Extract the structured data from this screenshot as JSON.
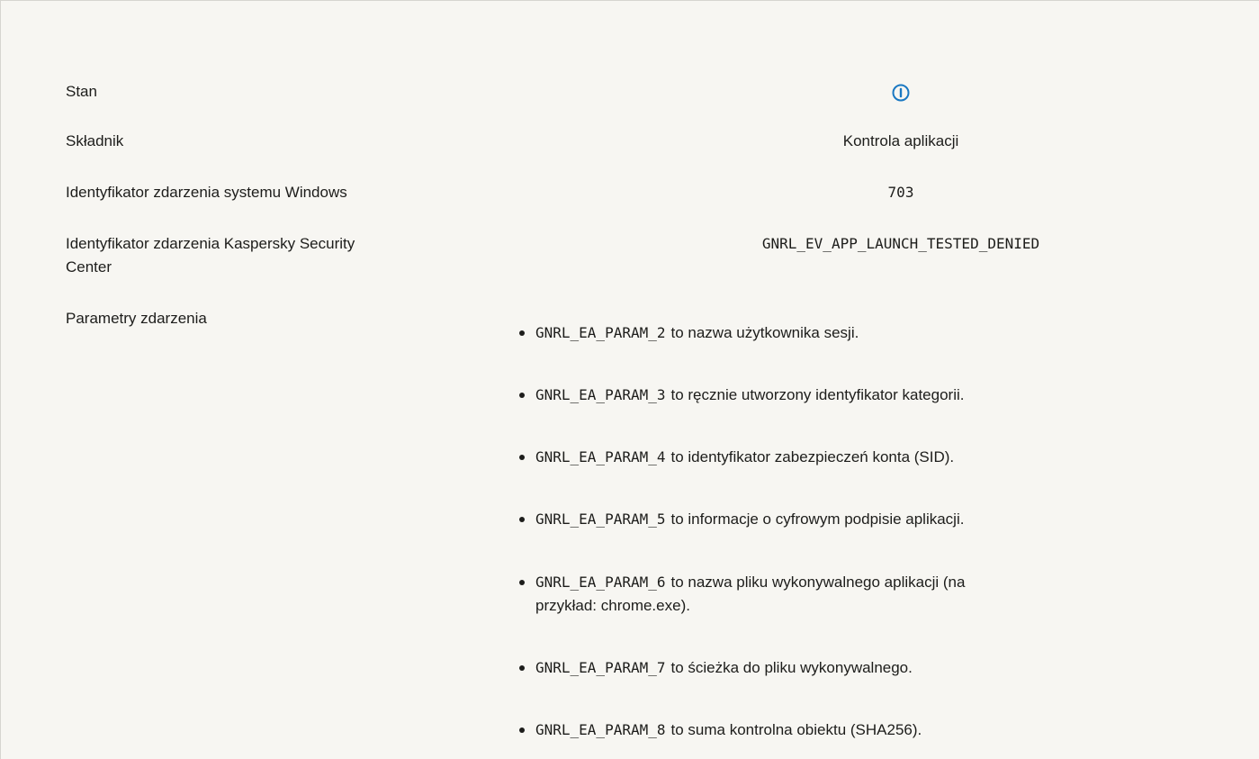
{
  "rows": [
    {
      "label": "Stan",
      "value_icon": "info-icon"
    },
    {
      "label": "Składnik",
      "value": "Kontrola aplikacji"
    },
    {
      "label": "Identyfikator zdarzenia systemu Windows",
      "value": "703"
    },
    {
      "label_line1": "Identyfikator zdarzenia Kaspersky Security",
      "label_line2": "Center",
      "value": "GNRL_EV_APP_LAUNCH_TESTED_DENIED"
    },
    {
      "label": "Parametry zdarzenia"
    }
  ],
  "params": [
    {
      "code": "GNRL_EA_PARAM_2",
      "text": "to nazwa użytkownika sesji."
    },
    {
      "code": "GNRL_EA_PARAM_3",
      "text": "to ręcznie utworzony identyfikator kategorii."
    },
    {
      "code": "GNRL_EA_PARAM_4",
      "text": "to identyfikator zabezpieczeń konta (SID)."
    },
    {
      "code": "GNRL_EA_PARAM_5",
      "text": "to informacje o cyfrowym podpisie aplikacji."
    },
    {
      "code": "GNRL_EA_PARAM_6",
      "text": "to nazwa pliku wykonywalnego aplikacji (na",
      "text2": "przykład: chrome.exe)."
    },
    {
      "code": "GNRL_EA_PARAM_7",
      "text": "to ścieżka do pliku wykonywalnego."
    },
    {
      "code": "GNRL_EA_PARAM_8",
      "text": "to suma kontrolna obiektu (SHA256)."
    }
  ],
  "colors": {
    "background": "#f7f6f2",
    "text": "#1d1d1b",
    "info_icon": "#1a78c2"
  }
}
